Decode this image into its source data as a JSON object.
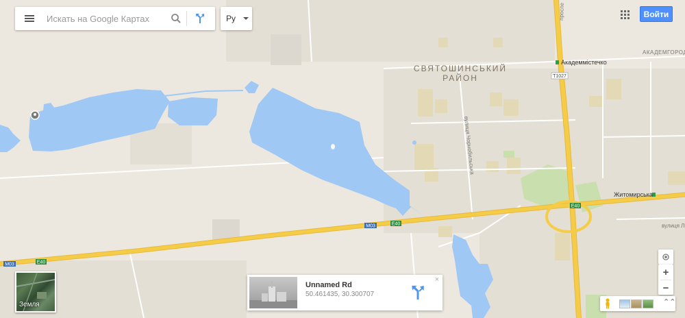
{
  "search": {
    "placeholder": "Искать на Google Картах"
  },
  "language": {
    "label": "Ру"
  },
  "header": {
    "signin_label": "Войти"
  },
  "map": {
    "district_line1": "СВЯТОШИНСЬКИЙ",
    "district_line2": "РАЙОН",
    "metro_akadem": "Академмістечко",
    "metro_zhytomyrska": "Житомирська",
    "road_akademgorod": "АКАДЕМГОРОД",
    "road_prospekt": "проспе",
    "road_chornobylska": "вулиця Чорнобильська",
    "road_lviv": "вулиця Льв",
    "shield_m03_left": "M03",
    "shield_e40_left": "E40",
    "shield_m03_mid": "M03",
    "shield_e40_mid": "E40",
    "shield_e40_right": "E40",
    "shield_t1027": "T1027"
  },
  "layer_toggle": {
    "label": "Земля"
  },
  "place_card": {
    "name": "Unnamed Rd",
    "coords": "50.461435, 30.300707",
    "close": "×"
  },
  "controls": {
    "zoom_in": "+",
    "zoom_out": "−",
    "expand": "⌃⌃"
  },
  "icons": {
    "menu": "menu-icon",
    "search": "search-icon",
    "directions": "directions-icon",
    "apps": "apps-grid-icon",
    "location": "my-location-icon",
    "pegman": "pegman-icon"
  },
  "colors": {
    "land": "#ece8df",
    "water": "#a0c8f5",
    "highway": "#f5cc47",
    "park": "#c9dfae",
    "building": "#e4d9b5",
    "signin": "#4d90fe",
    "directions": "#4e93ee"
  }
}
